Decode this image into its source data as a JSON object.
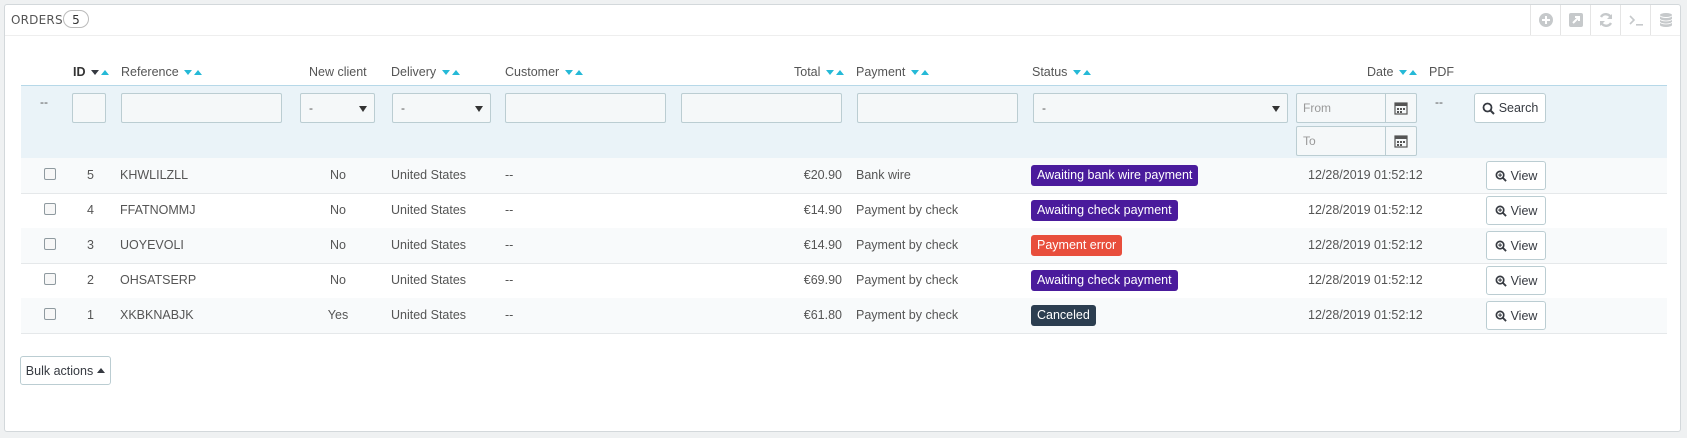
{
  "panel": {
    "title": "ORDERS",
    "count": "5"
  },
  "toolbar": [
    "add-icon",
    "export-icon",
    "refresh-icon",
    "terminal-icon",
    "database-icon"
  ],
  "headers": {
    "id": "ID",
    "reference": "Reference",
    "new_client": "New client",
    "delivery": "Delivery",
    "customer": "Customer",
    "total": "Total",
    "payment": "Payment",
    "status": "Status",
    "date": "Date",
    "pdf": "PDF"
  },
  "filters": {
    "checkbox_placeholder": "--",
    "new_client": "-",
    "delivery": "-",
    "status": "-",
    "date_from": "From",
    "date_to": "To",
    "pdf": "--",
    "search_label": "Search"
  },
  "orders": [
    {
      "id": "5",
      "reference": "KHWLILZLL",
      "new_client": "No",
      "delivery": "United States",
      "customer": "--",
      "total": "€20.90",
      "payment": "Bank wire",
      "status": "Awaiting bank wire payment",
      "status_color": "#4a1b9c",
      "date": "12/28/2019 01:52:12",
      "view": "View"
    },
    {
      "id": "4",
      "reference": "FFATNOMMJ",
      "new_client": "No",
      "delivery": "United States",
      "customer": "--",
      "total": "€14.90",
      "payment": "Payment by check",
      "status": "Awaiting check payment",
      "status_color": "#4a1b9c",
      "date": "12/28/2019 01:52:12",
      "view": "View"
    },
    {
      "id": "3",
      "reference": "UOYEVOLI",
      "new_client": "No",
      "delivery": "United States",
      "customer": "--",
      "total": "€14.90",
      "payment": "Payment by check",
      "status": "Payment error",
      "status_color": "#e84e3c",
      "date": "12/28/2019 01:52:12",
      "view": "View"
    },
    {
      "id": "2",
      "reference": "OHSATSERP",
      "new_client": "No",
      "delivery": "United States",
      "customer": "--",
      "total": "€69.90",
      "payment": "Payment by check",
      "status": "Awaiting check payment",
      "status_color": "#4a1b9c",
      "date": "12/28/2019 01:52:12",
      "view": "View"
    },
    {
      "id": "1",
      "reference": "XKBKNABJK",
      "new_client": "Yes",
      "delivery": "United States",
      "customer": "--",
      "total": "€61.80",
      "payment": "Payment by check",
      "status": "Canceled",
      "status_color": "#2c3e50",
      "date": "12/28/2019 01:52:12",
      "view": "View"
    }
  ],
  "bulk_actions": "Bulk actions"
}
